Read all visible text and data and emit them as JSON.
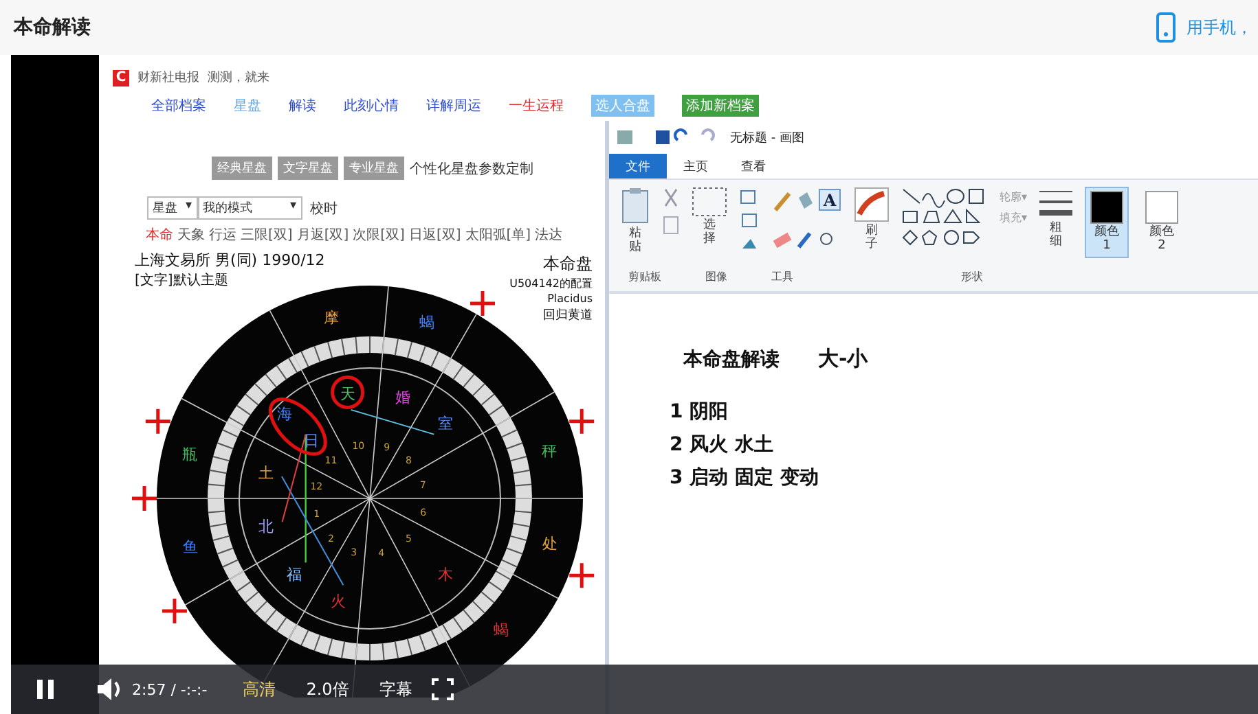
{
  "header": {
    "title": "本命解读",
    "mobile_link": "用手机，"
  },
  "video": {
    "webpage": {
      "brand": "财新社电报",
      "brand_logo": "C",
      "tagline": "测测，就来",
      "nav": [
        {
          "label": "全部档案",
          "kind": "link",
          "selected": false
        },
        {
          "label": "星盘",
          "kind": "link",
          "selected": true
        },
        {
          "label": "解读",
          "kind": "link",
          "selected": false
        },
        {
          "label": "此刻心情",
          "kind": "link",
          "selected": false
        },
        {
          "label": "详解周运",
          "kind": "link",
          "selected": false
        },
        {
          "label": "一生运程",
          "kind": "hot",
          "selected": false
        },
        {
          "label": "选人合盘",
          "kind": "blue",
          "selected": false
        },
        {
          "label": "添加新档案",
          "kind": "green",
          "selected": false
        }
      ],
      "style_buttons": [
        "经典星盘",
        "文字星盘",
        "专业星盘"
      ],
      "settings_link": "个性化星盘参数定制",
      "selects": [
        {
          "label": "星盘",
          "arrow": "▾"
        },
        {
          "label": "我的模式",
          "arrow": "▾"
        }
      ],
      "calibrate": "校时",
      "chart_tabs": [
        {
          "label": "本命",
          "selected": true
        },
        {
          "label": "天象",
          "selected": false
        },
        {
          "label": "行运",
          "selected": false
        },
        {
          "label": "三限[双]",
          "selected": false
        },
        {
          "label": "月返[双]",
          "selected": false
        },
        {
          "label": "次限[双]",
          "selected": false
        },
        {
          "label": "日返[双]",
          "selected": false
        },
        {
          "label": "太阳弧[单]",
          "selected": false
        },
        {
          "label": "法达",
          "selected": false
        }
      ],
      "chart": {
        "person": "上海文易所 男(同) 1990/12",
        "theme": "[文字]默认主题",
        "chart_name": "本命盘",
        "config": "U504142的配置",
        "house_system": "Placidus",
        "zodiac": "回归黄道",
        "signs": [
          {
            "label": "摩",
            "color": "#e0a040"
          },
          {
            "label": "瓶",
            "color": "#40c060"
          },
          {
            "label": "鱼",
            "color": "#4080ff"
          },
          {
            "label": "秤",
            "color": "#40c060"
          },
          {
            "label": "处",
            "color": "#e0a040"
          },
          {
            "label": "蝎",
            "color": "#e03030"
          },
          {
            "label": "蝎",
            "color": "#4080ff"
          }
        ],
        "planets": [
          {
            "label": "婚",
            "color": "#e040e0"
          },
          {
            "label": "室",
            "color": "#6090ff"
          },
          {
            "label": "天",
            "color": "#40c060"
          },
          {
            "label": "海",
            "color": "#4080ff"
          },
          {
            "label": "日",
            "color": "#6090ff"
          },
          {
            "label": "土",
            "color": "#e0a040"
          },
          {
            "label": "北",
            "color": "#a0a0ff"
          },
          {
            "label": "福",
            "color": "#80c0ff"
          },
          {
            "label": "火",
            "color": "#e03030"
          },
          {
            "label": "木",
            "color": "#e03030"
          }
        ],
        "house_numbers": [
          "1",
          "2",
          "3",
          "4",
          "5",
          "6",
          "7",
          "8",
          "9",
          "10",
          "11",
          "12"
        ]
      }
    },
    "paint": {
      "title": "无标题 - 画图",
      "tabs": [
        {
          "label": "文件",
          "selected": true
        },
        {
          "label": "主页",
          "selected": false
        },
        {
          "label": "查看",
          "selected": false
        }
      ],
      "tools": {
        "paste": "粘贴",
        "select": "选择",
        "brush": "刷子",
        "text_tool": "A",
        "outline": "轮廓▾",
        "fill": "填充▾",
        "size": "粗细",
        "colors": [
          {
            "label": "颜色 1",
            "color": "#000000",
            "selected": true
          },
          {
            "label": "颜色 2",
            "color": "#ffffff",
            "selected": false
          }
        ]
      },
      "groups": [
        "剪贴板",
        "图像",
        "工具",
        "形状"
      ],
      "canvas": {
        "heading": "本命盘解读",
        "subheading": "大-小",
        "lines": [
          "1  阴阳",
          "2 风火 水土",
          "3 启动 固定 变动"
        ]
      }
    },
    "player": {
      "playing": true,
      "time": "2:57 / -:-:-",
      "quality": "高清",
      "speed": "2.0倍",
      "subtitles": "字幕"
    }
  }
}
